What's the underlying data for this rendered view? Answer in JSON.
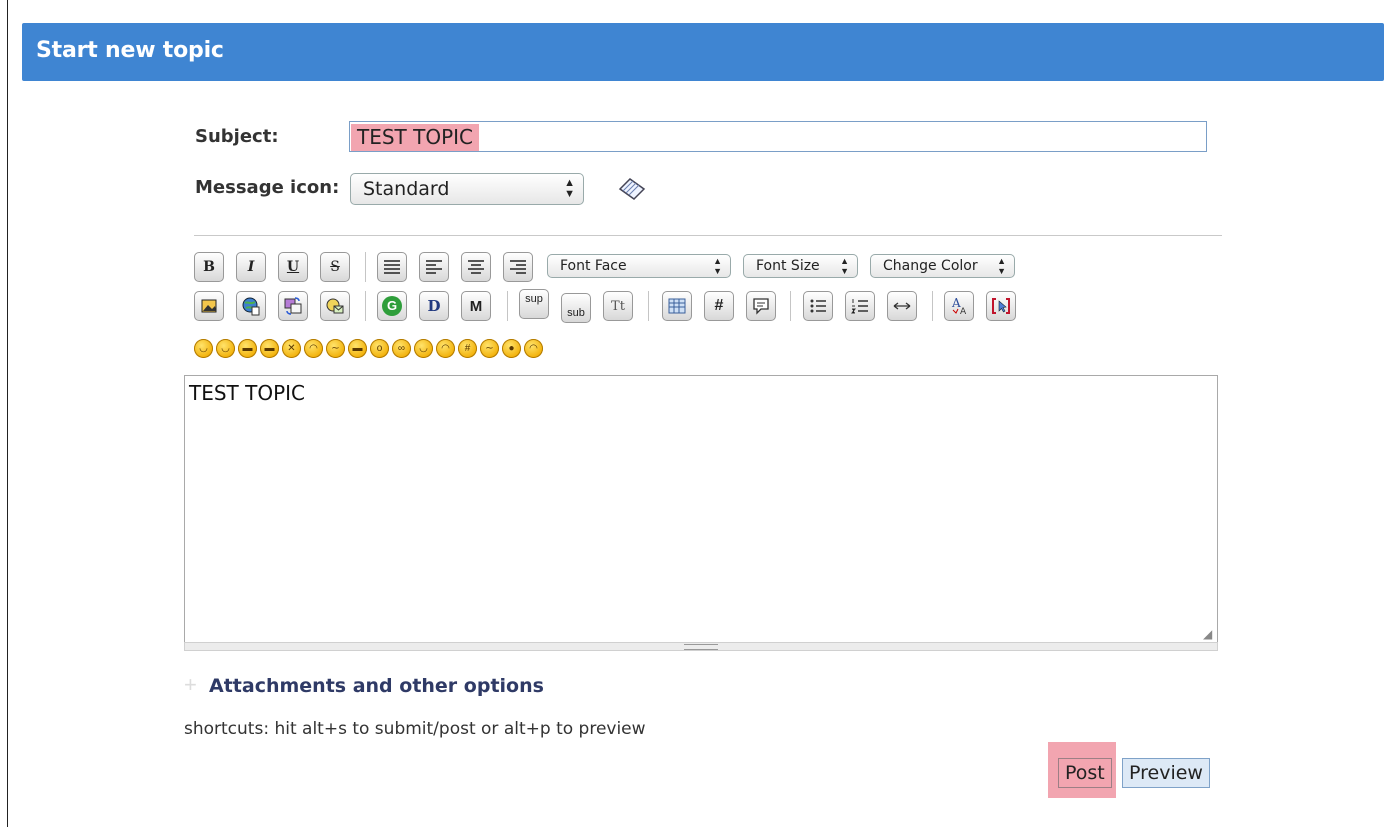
{
  "header": {
    "title": "Start new topic"
  },
  "subject": {
    "label": "Subject:",
    "value": "TEST TOPIC"
  },
  "message_icon": {
    "label": "Message icon:",
    "selected": "Standard"
  },
  "toolbar": {
    "row1_buttons": [
      {
        "name": "bold-button",
        "glyph": "B"
      },
      {
        "name": "italic-button",
        "glyph": "I"
      },
      {
        "name": "underline-button",
        "glyph": "U"
      },
      {
        "name": "strikethrough-button",
        "glyph": "S"
      }
    ],
    "font_face": "Font Face",
    "font_size": "Font Size",
    "change_color": "Change Color",
    "sup_label": "sup",
    "sub_label": "sub",
    "tt_label": "Tt",
    "hash_label": "#",
    "g_label": "G",
    "d_label": "D",
    "m_label": "M"
  },
  "message": {
    "value": "TEST TOPIC"
  },
  "attachments_label": "Attachments and other options",
  "shortcuts_text": "shortcuts: hit alt+s to submit/post or alt+p to preview",
  "buttons": {
    "post": "Post",
    "preview": "Preview"
  },
  "colors": {
    "header_bg": "#3f85d2",
    "highlight": "#f2a5b0",
    "preview_bg": "#dde9f6"
  }
}
